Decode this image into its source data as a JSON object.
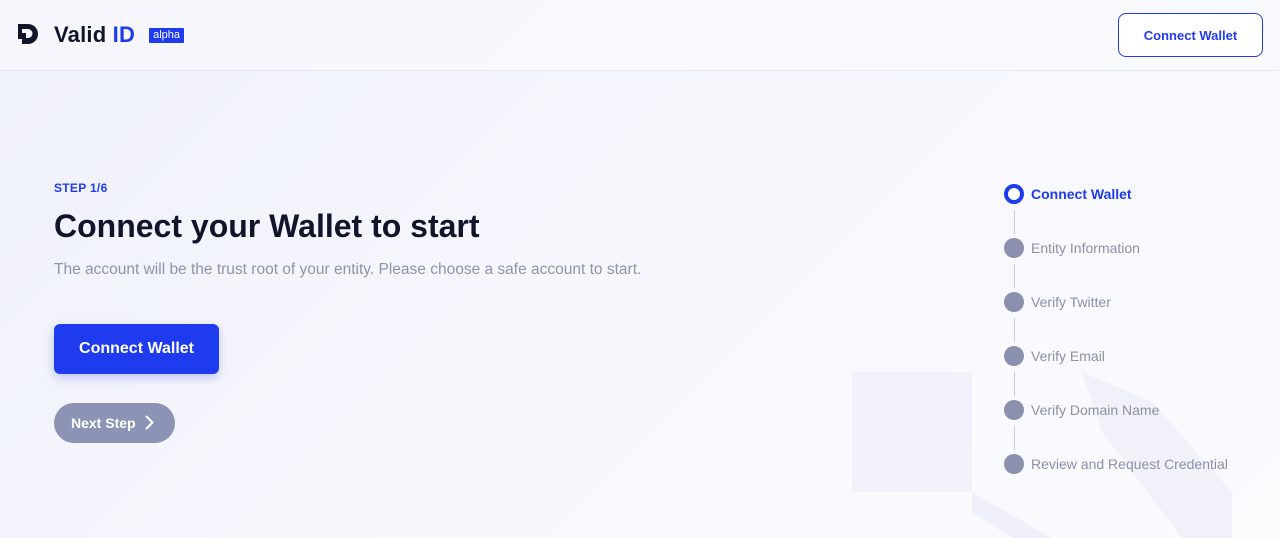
{
  "header": {
    "logo_text": "Valid",
    "logo_accent": "ID",
    "badge": "alpha",
    "connect_button": "Connect Wallet"
  },
  "main": {
    "step_label": "STEP 1/6",
    "title": "Connect your Wallet to start",
    "subtitle": "The account will be the trust root of your entity. Please choose a safe account to start.",
    "connect_button": "Connect Wallet",
    "next_button": "Next Step"
  },
  "steps": {
    "items": [
      {
        "label": "Connect Wallet",
        "active": true
      },
      {
        "label": "Entity Information",
        "active": false
      },
      {
        "label": "Verify Twitter",
        "active": false
      },
      {
        "label": "Verify Email",
        "active": false
      },
      {
        "label": "Verify Domain Name",
        "active": false
      },
      {
        "label": "Review and Request Credential",
        "active": false
      }
    ]
  },
  "colors": {
    "accent": "#1f3bf0",
    "muted": "#8b90ae",
    "text": "#11152a"
  }
}
